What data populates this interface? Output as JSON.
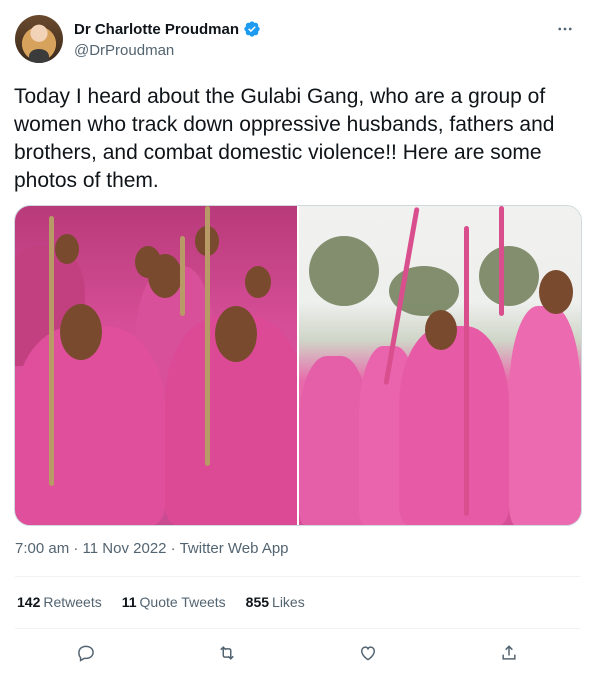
{
  "author": {
    "name": "Dr Charlotte Proudman",
    "handle": "@DrProudman"
  },
  "tweet": {
    "text": "Today I heard about the Gulabi Gang, who are a group of women who track down oppressive husbands, fathers and brothers, and combat domestic violence!! Here are some photos of them."
  },
  "meta": {
    "time": "7:00 am",
    "separator": " · ",
    "date": "11 Nov 2022",
    "source": "Twitter Web App"
  },
  "stats": {
    "retweets_count": "142",
    "retweets_label": "Retweets",
    "quotes_count": "11",
    "quotes_label": "Quote Tweets",
    "likes_count": "855",
    "likes_label": "Likes"
  },
  "colors": {
    "verified": "#1d9bf0",
    "secondary_text": "#536471",
    "primary_text": "#0f1419"
  },
  "icons": [
    "verified-badge-icon",
    "more-icon",
    "reply-icon",
    "retweet-icon",
    "like-icon",
    "share-icon"
  ]
}
